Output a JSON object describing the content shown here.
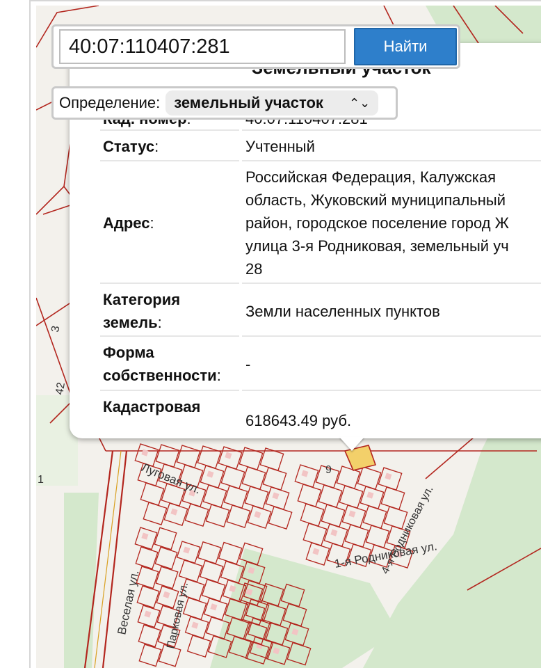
{
  "search": {
    "value": "40:07:110407:281",
    "button_label": "Найти"
  },
  "definition": {
    "label": "Определение:",
    "selected": "земельный участок",
    "updown_glyph": "⌃⌄"
  },
  "popup": {
    "title": "Земельный участок",
    "rows": [
      {
        "label": "Кад. номер",
        "value": "40:07:110407:281"
      },
      {
        "label": "Статус",
        "value": "Учтенный"
      },
      {
        "label": "Адрес",
        "value_lines": [
          "Российская Федерация, Калужская",
          "область, Жуковский муниципальный",
          "район, городское поселение город Ж",
          "улица 3-я Родниковая, земельный уч",
          "28"
        ]
      },
      {
        "label_lines": [
          "Категория",
          "земель"
        ],
        "value": "Земли населенных пунктов"
      },
      {
        "label_lines": [
          "Форма",
          "собственности"
        ],
        "value": "-"
      },
      {
        "label": "Кадастровая",
        "value": "618643.49 руб."
      }
    ]
  },
  "map": {
    "street_labels": [
      "Луговая ул.",
      "Веселая ул.",
      "Парковая ул.",
      "4-я Родниковая ул.",
      "1-я Родниковая ул.",
      "3",
      "42",
      "1",
      "9"
    ],
    "colors": {
      "background": "#f3f1ec",
      "green": "#d4e8cc",
      "parcel_line": "#b3261e",
      "building": "#f2c4c4",
      "selected": "#f3d06a"
    }
  }
}
